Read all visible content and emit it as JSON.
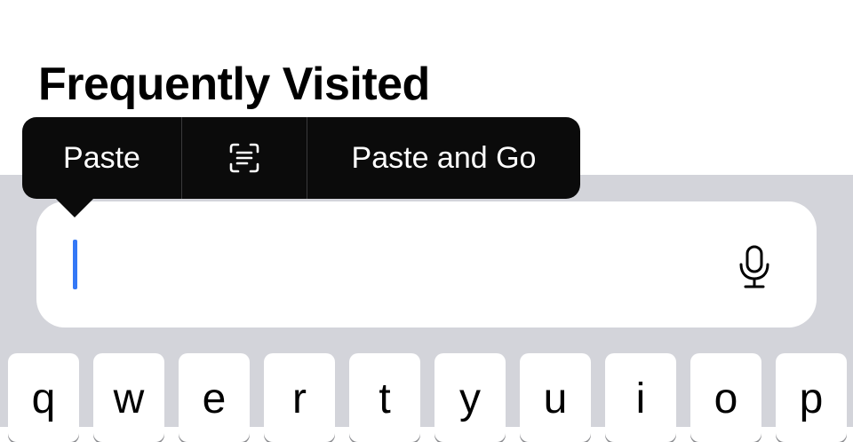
{
  "section": {
    "title": "Frequently Visited"
  },
  "context_menu": {
    "paste_label": "Paste",
    "scan_text_icon": "text-scan-icon",
    "paste_and_go_label": "Paste and Go"
  },
  "address_field": {
    "mic_icon": "microphone-icon"
  },
  "keyboard": {
    "row1": [
      "q",
      "w",
      "e",
      "r",
      "t",
      "y",
      "u",
      "i",
      "o",
      "p"
    ]
  },
  "colors": {
    "cursor": "#3478f6",
    "menu_bg": "#0b0b0b",
    "keyboard_bg": "#d3d4da"
  }
}
